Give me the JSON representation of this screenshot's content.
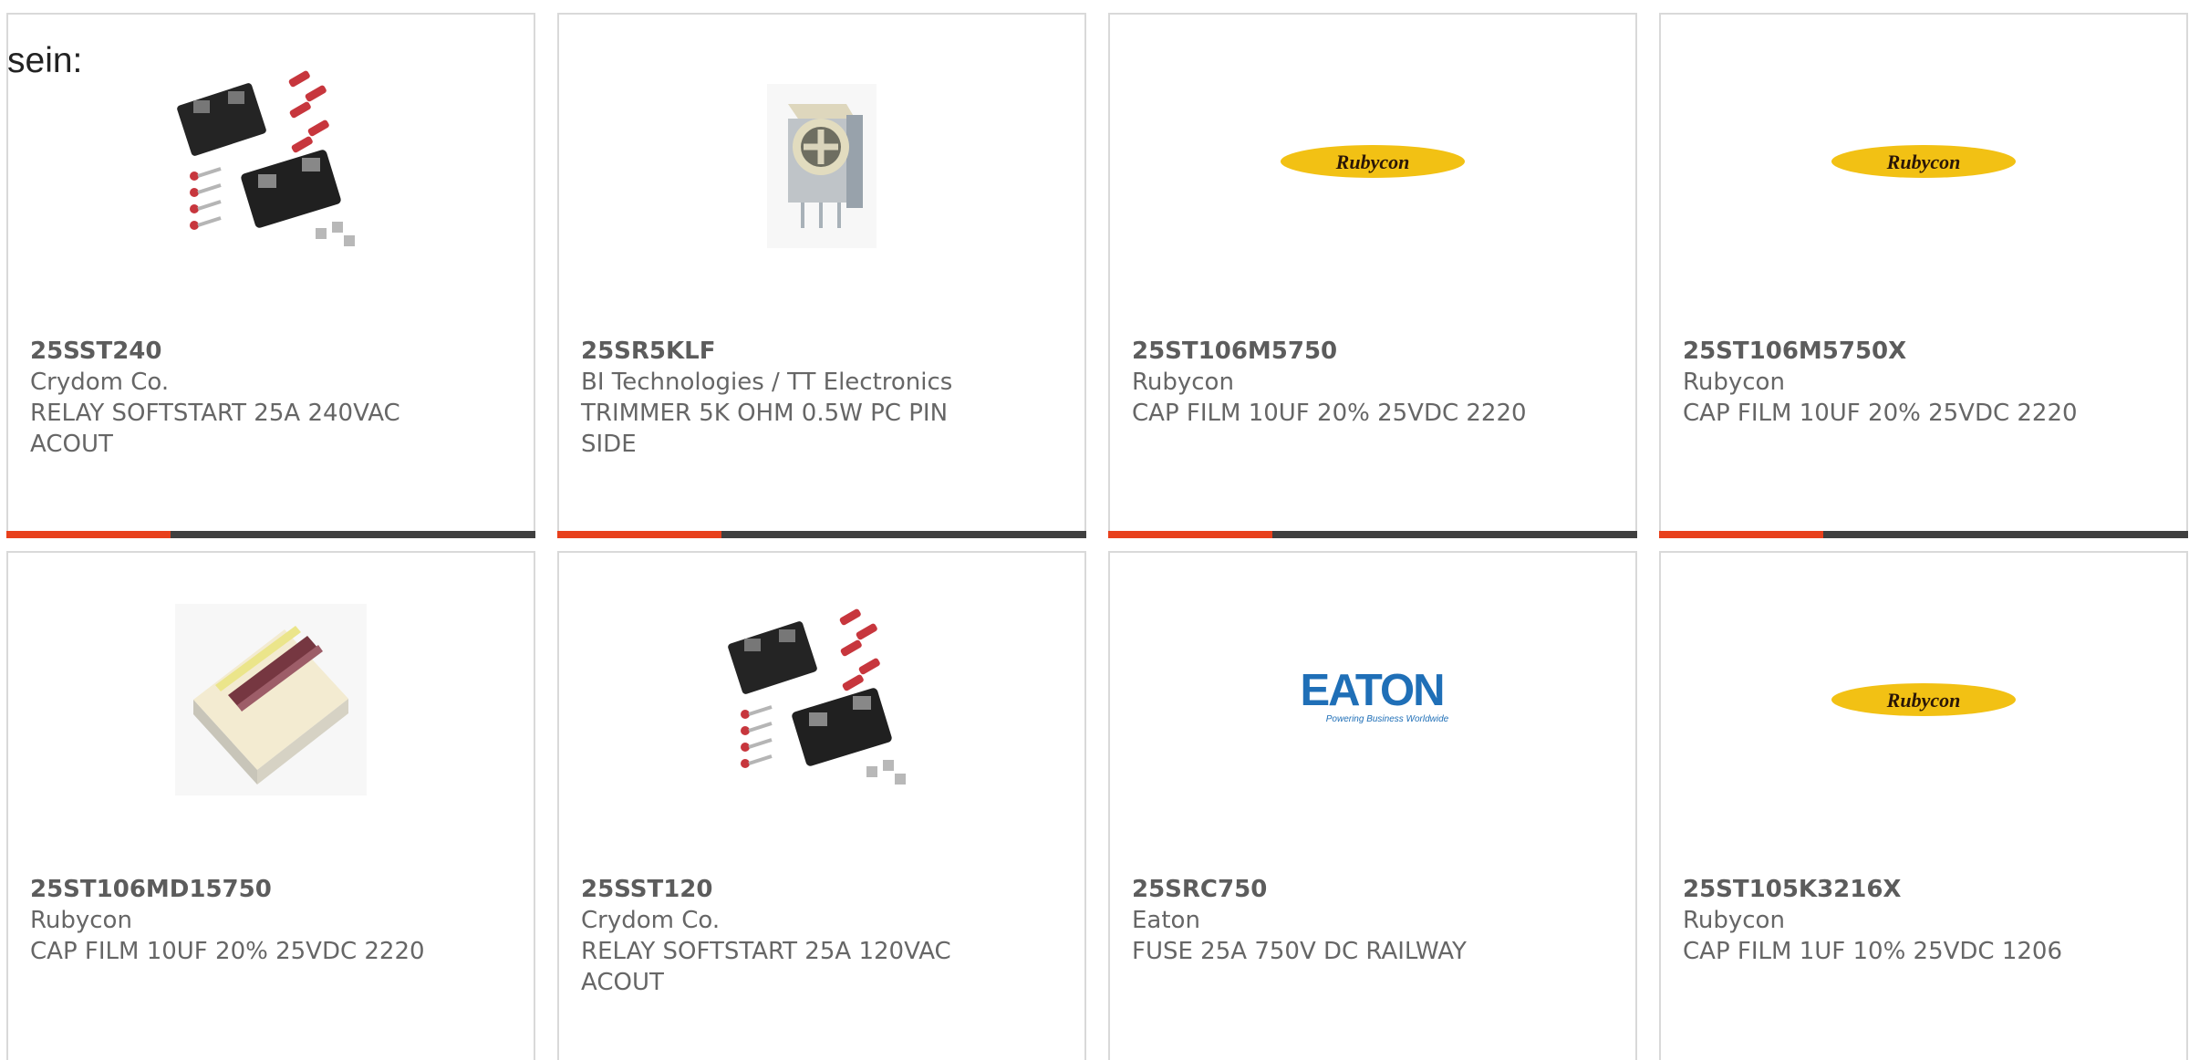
{
  "intro_text": "sein:",
  "colors": {
    "card_border": "#d9d9d9",
    "bar_track": "#3f3f3f",
    "bar_fill": "#e8401c",
    "part_number": "#5c5c5c",
    "secondary_text": "#666666",
    "rubycon_yellow": "#f2c114",
    "eaton_blue": "#1f6fb7"
  },
  "products": [
    {
      "part_number": "25SST240",
      "manufacturer": "Crydom Co.",
      "description": "RELAY SOFTSTART 25A 240VAC ACOUT",
      "image_icon": "solid-state-relay-icon",
      "progress_fraction": 0.31
    },
    {
      "part_number": "25SR5KLF",
      "manufacturer": "BI Technologies / TT Electronics",
      "description": "TRIMMER 5K OHM 0.5W PC PIN SIDE",
      "image_icon": "trimmer-potentiometer-icon",
      "progress_fraction": 0.31
    },
    {
      "part_number": "25ST106M5750",
      "manufacturer": "Rubycon",
      "description": "CAP FILM 10UF 20% 25VDC 2220",
      "image_icon": "rubycon-logo",
      "logo_text": "Rubycon",
      "progress_fraction": 0.31
    },
    {
      "part_number": "25ST106M5750X",
      "manufacturer": "Rubycon",
      "description": "CAP FILM 10UF 20% 25VDC 2220",
      "image_icon": "rubycon-logo",
      "logo_text": "Rubycon",
      "progress_fraction": 0.31
    },
    {
      "part_number": "25ST106MD15750",
      "manufacturer": "Rubycon",
      "description": "CAP FILM 10UF 20% 25VDC 2220",
      "image_icon": "film-capacitor-icon"
    },
    {
      "part_number": "25SST120",
      "manufacturer": "Crydom Co.",
      "description": "RELAY SOFTSTART 25A 120VAC ACOUT",
      "image_icon": "solid-state-relay-icon"
    },
    {
      "part_number": "25SRC750",
      "manufacturer": "Eaton",
      "description": "FUSE 25A 750V DC RAILWAY",
      "image_icon": "eaton-logo",
      "logo_text": "EATON",
      "logo_tagline": "Powering Business Worldwide"
    },
    {
      "part_number": "25ST105K3216X",
      "manufacturer": "Rubycon",
      "description": "CAP FILM 1UF 10% 25VDC 1206",
      "image_icon": "rubycon-logo",
      "logo_text": "Rubycon"
    }
  ]
}
